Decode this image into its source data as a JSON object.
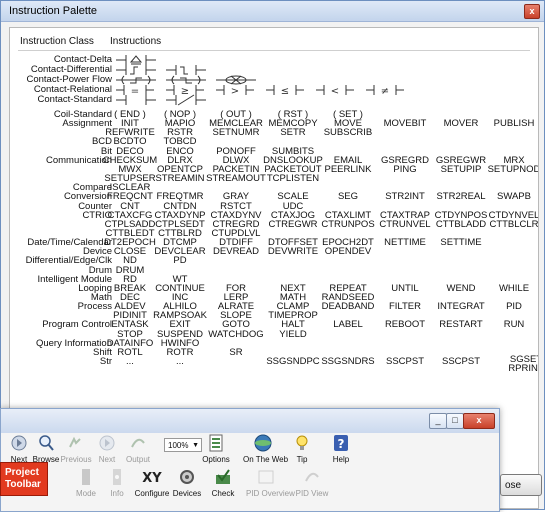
{
  "window": {
    "title": "Instruction Palette",
    "close_symbol": "x"
  },
  "columns": {
    "instruction_class": "Instruction Class",
    "instructions": "Instructions"
  },
  "ladder_rows": [
    "Contact-Delta",
    "Contact-Differential",
    "Contact-Power Flow",
    "Contact-Relational",
    "Contact-Standard"
  ],
  "rows": [
    {
      "cls": "Coil-Standard",
      "cells": [
        "( END )",
        "( NOP )",
        "( OUT )",
        "( RST )",
        "( SET )"
      ]
    },
    {
      "cls": "Assignment",
      "cells": [
        "INIT",
        "MAPIO",
        "MEMCLEAR",
        "MEMCOPY",
        "MOVE",
        "MOVEBIT",
        "MOVER",
        "PUBLISH"
      ]
    },
    {
      "cls": "",
      "cells": [
        "REFWRITE",
        "RSTR",
        "SETNUMR",
        "SETR",
        "SUBSCRIB"
      ]
    },
    {
      "cls": "BCD",
      "cells": [
        "BCDTO",
        "TOBCD"
      ]
    },
    {
      "cls": "Bit",
      "cells": [
        "DECO",
        "ENCO",
        "PONOFF",
        "SUMBITS"
      ]
    },
    {
      "cls": "Communication",
      "cells": [
        "CHECKSUM",
        "DLRX",
        "DLWX",
        "DNSLOOKUP",
        "EMAIL",
        "GSREGRD",
        "GSREGWR",
        "MRX"
      ]
    },
    {
      "cls": "",
      "cells": [
        "MWX",
        "OPENTCP",
        "PACKETIN",
        "PACKETOUT",
        "PEERLINK",
        "PING",
        "SETUPIP",
        "SETUPNOD"
      ]
    },
    {
      "cls": "",
      "cells": [
        "SETUPSER",
        "STREAMIN",
        "STREAMOUT",
        "TCPLISTEN"
      ]
    },
    {
      "cls": "Compare",
      "cells": [
        "ISCLEAR"
      ]
    },
    {
      "cls": "Conversion",
      "cells": [
        "FREQCNT",
        "FREQTMR",
        "GRAY",
        "SCALE",
        "SEG",
        "STR2INT",
        "STR2REAL",
        "SWAPB"
      ]
    },
    {
      "cls": "Counter",
      "cells": [
        "CNT",
        "CNTDN",
        "RSTCT",
        "UDC"
      ]
    },
    {
      "cls": "CTRIO",
      "cells": [
        "CTAXCFG",
        "CTAXDYNP",
        "CTAXDYNV",
        "CTAXJOG",
        "CTAXLIMT",
        "CTAXTRAP",
        "CTDYNPOS",
        "CTDYNVEL"
      ]
    },
    {
      "cls": "",
      "cells": [
        "CTPLSADD",
        "CTPLSEDT",
        "CTREGRD",
        "CTREGWR",
        "CTRUNPOS",
        "CTRUNVEL",
        "CTTBLADD",
        "CTTBLCLR"
      ]
    },
    {
      "cls": "",
      "cells": [
        "CTTBLEDT",
        "CTTBLRD",
        "CTUPDLVL"
      ]
    },
    {
      "cls": "Date/Time/Calendar",
      "cells": [
        "DT2EPOCH",
        "DTCMP",
        "DTDIFF",
        "DTOFFSET",
        "EPOCH2DT",
        "NETTIME",
        "SETTIME"
      ]
    },
    {
      "cls": "Device",
      "cells": [
        "CLOSE",
        "DEVCLEAR",
        "DEVREAD",
        "DEVWRITE",
        "OPENDEV"
      ]
    },
    {
      "cls": "Differential/Edge/Clk",
      "cells": [
        "ND",
        "PD"
      ]
    },
    {
      "cls": "Drum",
      "cells": [
        "DRUM"
      ]
    },
    {
      "cls": "Intelligent Module",
      "cells": [
        "RD",
        "WT"
      ]
    },
    {
      "cls": "Looping",
      "cells": [
        "BREAK",
        "CONTINUE",
        "FOR",
        "NEXT",
        "REPEAT",
        "UNTIL",
        "WEND",
        "WHILE"
      ]
    },
    {
      "cls": "Math",
      "cells": [
        "DEC",
        "INC",
        "LERP",
        "MATH",
        "RANDSEED"
      ]
    },
    {
      "cls": "Process",
      "cells": [
        "ALDEV",
        "ALHILO",
        "ALRATE",
        "CLAMP",
        "DEADBAND",
        "FILTER",
        "INTEGRAT",
        "PID"
      ]
    },
    {
      "cls": "",
      "cells": [
        "PIDINIT",
        "RAMPSOAK",
        "SLOPE",
        "TIMEPROP"
      ]
    },
    {
      "cls": "Program Control",
      "cells": [
        "ENTASK",
        "EXIT",
        "GOTO",
        "HALT",
        "LABEL",
        "REBOOT",
        "RESTART",
        "RUN"
      ]
    },
    {
      "cls": "",
      "cells": [
        "STOP",
        "SUSPEND",
        "WATCHDOG",
        "YIELD"
      ]
    },
    {
      "cls": "Query Information",
      "cells": [
        "DATAINFO",
        "HWINFO"
      ]
    },
    {
      "cls": "Shift",
      "cells": [
        "ROTL",
        "ROTR",
        "SR"
      ]
    }
  ],
  "partial_row": {
    "cls": "Str",
    "cells": [
      "...",
      "...",
      "",
      "SSGSNDPC",
      "SSGSNDRS",
      "SSCPST",
      "SSCPST"
    ]
  },
  "right_clip": [
    "SGSET",
    "RPRINT"
  ],
  "overlay": {
    "toolbar_top": [
      {
        "label": "Next",
        "icon": "next-icon",
        "enabled": true
      },
      {
        "label": "Browse",
        "icon": "browse-icon",
        "enabled": true
      },
      {
        "label": "Previous",
        "icon": "previous-icon",
        "enabled": false
      },
      {
        "label": "Next",
        "icon": "next-icon",
        "enabled": false
      },
      {
        "label": "Output",
        "icon": "output-icon",
        "enabled": false
      },
      {
        "label": "Options",
        "icon": "options-icon",
        "enabled": true
      },
      {
        "label": "On The Web",
        "icon": "web-icon",
        "enabled": true
      },
      {
        "label": "Tip",
        "icon": "tip-icon",
        "enabled": true
      },
      {
        "label": "Help",
        "icon": "help-icon",
        "enabled": true
      }
    ],
    "toolbar_bottom": [
      {
        "label": "Mode",
        "icon": "mode-icon",
        "enabled": false
      },
      {
        "label": "Info",
        "icon": "info-icon",
        "enabled": false
      },
      {
        "label": "Configure",
        "icon": "configure-icon",
        "enabled": true
      },
      {
        "label": "Devices",
        "icon": "devices-icon",
        "enabled": true
      },
      {
        "label": "Check",
        "icon": "check-icon",
        "enabled": true
      },
      {
        "label": "PID Overview",
        "icon": "pid-overview-icon",
        "enabled": false
      },
      {
        "label": "PID View",
        "icon": "pid-view-icon",
        "enabled": false
      }
    ],
    "zoom_value": "100%",
    "project_note": "Project\nToolbar",
    "min_symbol": "_",
    "max_symbol": "□",
    "close_symbol": "x"
  },
  "close_button_label": "ose",
  "colors": {
    "accent_red": "#e23a1f",
    "titlebar_blue": "#c3d4ec"
  }
}
